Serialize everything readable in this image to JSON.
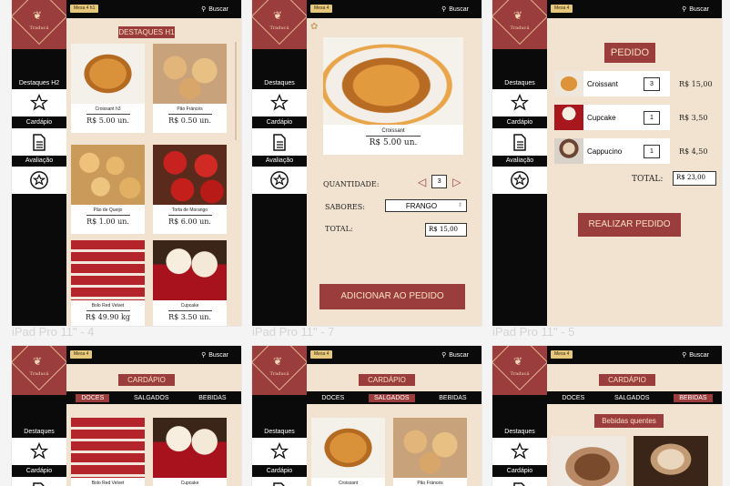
{
  "common": {
    "logo_text": "Traducá",
    "search_label": "Buscar",
    "nav": {
      "destaques": "Destaques",
      "cardapio": "Cardápio",
      "avaliacao": "Avaliação"
    }
  },
  "frames": {
    "f1": {
      "caption": "iPad Pro 11\" - 4",
      "mesa": "Mesa 4 h1",
      "nav_destaques": "Destaques H2",
      "heading": "DESTAQUES H1",
      "products": [
        {
          "name": "Croissant h3",
          "price": "R$ 5.00 un."
        },
        {
          "name": "Pão Fráncés",
          "price": "R$ 0.50 un."
        },
        {
          "name": "Pão de Queijo",
          "price": "R$ 1.00 un."
        },
        {
          "name": "Torta de Morango",
          "price": "R$ 6.00 un."
        },
        {
          "name": "Bolo Red Velvet",
          "price": "R$ 49.90 kg"
        },
        {
          "name": "Cupcake",
          "price": "R$ 3.50 un."
        }
      ]
    },
    "f2": {
      "caption": "iPad Pro 11\" - 7",
      "mesa": "Mesa 4",
      "product_name": "Croissant",
      "product_price": "R$ 5.00 un.",
      "qty_label": "QUANTIDADE:",
      "qty_value": "3",
      "flavor_label": "SABORES:",
      "flavor_value": "FRANGO",
      "total_label": "TOTAL:",
      "total_value": "R$ 15,00",
      "add_button": "ADICIONAR AO PEDIDO"
    },
    "f3": {
      "caption": "iPad Pro 11\" - 5",
      "mesa": "Mesa 4",
      "heading": "PEDIDO",
      "items": [
        {
          "name": "Croissant",
          "qty": "3",
          "price": "R$ 15,00"
        },
        {
          "name": "Cupcake",
          "qty": "1",
          "price": "R$ 3,50"
        },
        {
          "name": "Cappucino",
          "qty": "1",
          "price": "R$ 4,50"
        }
      ],
      "total_label": "TOTAL:",
      "total_value": "R$ 23,00",
      "order_button": "REALIZAR PEDIDO"
    },
    "f4": {
      "mesa": "Mesa 4",
      "heading": "CARDÁPIO",
      "tabs": [
        "DOCES",
        "SALGADOS",
        "BEBIDAS"
      ],
      "products": [
        {
          "name": "Bolo Red Velvet"
        },
        {
          "name": "Cupcake"
        }
      ]
    },
    "f5": {
      "mesa": "Mesa 4",
      "heading": "CARDÁPIO",
      "tabs": [
        "DOCES",
        "SALGADOS",
        "BEBIDAS"
      ],
      "products": [
        {
          "name": "Croissant"
        },
        {
          "name": "Pão Fráncés"
        }
      ]
    },
    "f6": {
      "mesa": "Mesa 4",
      "heading": "CARDÁPIO",
      "tabs": [
        "DOCES",
        "SALGADOS",
        "BEBIDAS"
      ],
      "subheading": "Bebidas quentes"
    }
  },
  "colors": {
    "accent": "#9c3d3d",
    "background": "#f1e3cf",
    "dark": "#0a0a0a",
    "badge": "#e6c87d"
  },
  "icons": [
    "croissant-logo-icon",
    "star-icon",
    "menu-book-icon",
    "review-badge-icon",
    "search-icon",
    "plus-icon"
  ]
}
